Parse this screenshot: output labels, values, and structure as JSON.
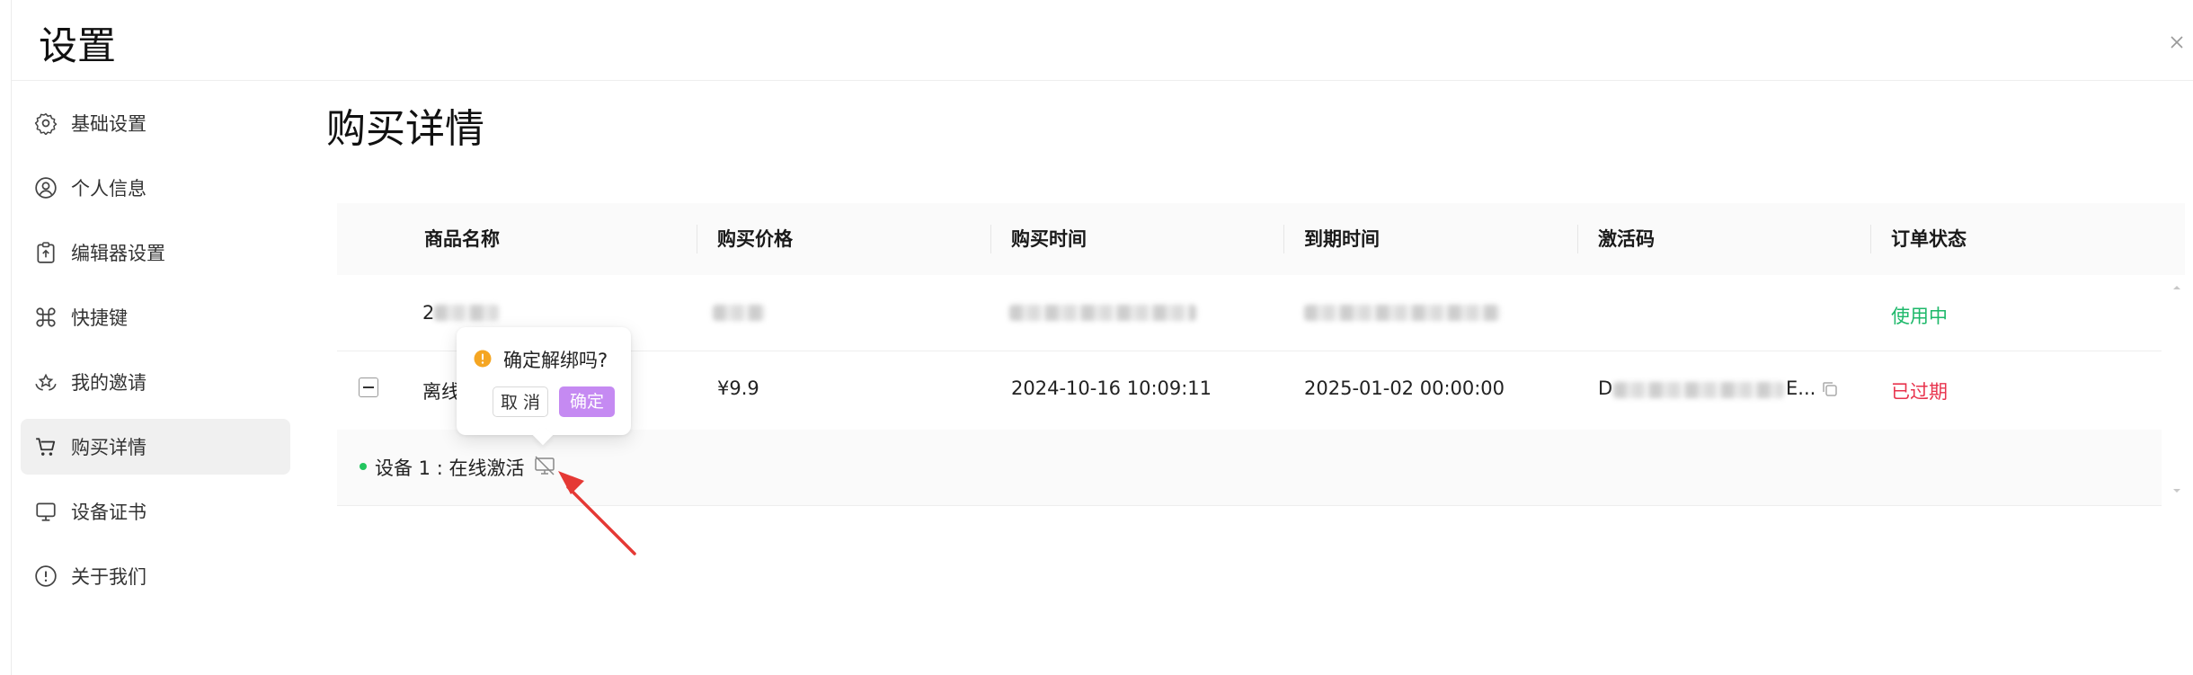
{
  "window": {
    "title": "设置"
  },
  "sidebar": {
    "items": [
      {
        "label": "基础设置",
        "icon": "gear-icon",
        "active": false
      },
      {
        "label": "个人信息",
        "icon": "user-circle-icon",
        "active": false
      },
      {
        "label": "编辑器设置",
        "icon": "editor-icon",
        "active": false
      },
      {
        "label": "快捷键",
        "icon": "command-key-icon",
        "active": false
      },
      {
        "label": "我的邀请",
        "icon": "invite-icon",
        "active": false
      },
      {
        "label": "购买详情",
        "icon": "cart-icon",
        "active": true
      },
      {
        "label": "设备证书",
        "icon": "monitor-icon",
        "active": false
      },
      {
        "label": "关于我们",
        "icon": "info-circle-icon",
        "active": false
      }
    ]
  },
  "main": {
    "title": "购买详情",
    "table": {
      "columns": [
        "商品名称",
        "购买价格",
        "购买时间",
        "到期时间",
        "激活码",
        "订单状态"
      ],
      "rows": [
        {
          "product": "2",
          "price": "",
          "purchase_time": "",
          "expire_time": "",
          "code": "",
          "status": "使用中",
          "status_color": "#1db86a"
        },
        {
          "product": "离线",
          "price": "¥9.9",
          "purchase_time": "2024-10-16 10:09:11",
          "expire_time": "2025-01-02 00:00:00",
          "code": "D",
          "code_tail": "E...",
          "status": "已过期",
          "status_color": "#e8334d"
        }
      ],
      "device": {
        "label": "设备 1 : 在线激活",
        "status_color": "#22c55e"
      }
    }
  },
  "popconfirm": {
    "message": "确定解绑吗?",
    "cancel_label": "取 消",
    "ok_label": "确定",
    "ok_color": "#c58af2"
  },
  "annotation": {
    "arrow_color": "#e53935"
  }
}
